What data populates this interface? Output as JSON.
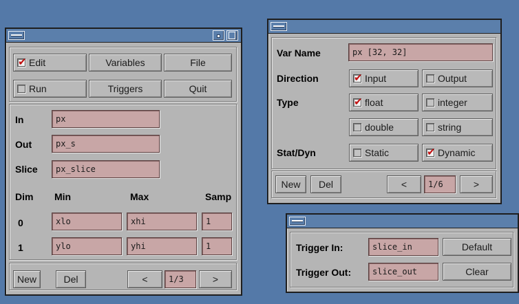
{
  "main_window": {
    "toolbar": {
      "edit": "Edit",
      "edit_checked": true,
      "variables": "Variables",
      "file": "File",
      "run": "Run",
      "run_checked": false,
      "triggers": "Triggers",
      "quit": "Quit"
    },
    "in_label": "In",
    "in_value": "px",
    "out_label": "Out",
    "out_value": "px_s",
    "slice_label": "Slice",
    "slice_value": "px_slice",
    "dims": {
      "headers": [
        "Dim",
        "Min",
        "Max",
        "Samp"
      ],
      "rows": [
        {
          "dim": "0",
          "min": "xlo",
          "max": "xhi",
          "samp": "1"
        },
        {
          "dim": "1",
          "min": "ylo",
          "max": "yhi",
          "samp": "1"
        }
      ]
    },
    "nav": {
      "new": "New",
      "del": "Del",
      "prev": "<",
      "page": "1/3",
      "next": ">"
    }
  },
  "var_window": {
    "var_name_label": "Var Name",
    "var_name_value": "px [32, 32]",
    "direction_label": "Direction",
    "direction_options": [
      {
        "label": "Input",
        "checked": true
      },
      {
        "label": "Output",
        "checked": false
      }
    ],
    "type_label": "Type",
    "type_options": [
      {
        "label": "float",
        "checked": true
      },
      {
        "label": "integer",
        "checked": false
      },
      {
        "label": "double",
        "checked": false
      },
      {
        "label": "string",
        "checked": false
      }
    ],
    "statdyn_label": "Stat/Dyn",
    "statdyn_options": [
      {
        "label": "Static",
        "checked": false
      },
      {
        "label": "Dynamic",
        "checked": true
      }
    ],
    "nav": {
      "new": "New",
      "del": "Del",
      "prev": "<",
      "page": "1/6",
      "next": ">"
    }
  },
  "trigger_window": {
    "trigger_in_label": "Trigger In:",
    "trigger_in_value": "slice_in",
    "default_button": "Default",
    "trigger_out_label": "Trigger Out:",
    "trigger_out_value": "slice_out",
    "clear_button": "Clear"
  },
  "colors": {
    "desktop": "#5479a8",
    "titlebar": "#5b7fab",
    "window_bg": "#b5b5b5",
    "field_bg": "#c8a6a6",
    "check_mark": "#c01010"
  }
}
